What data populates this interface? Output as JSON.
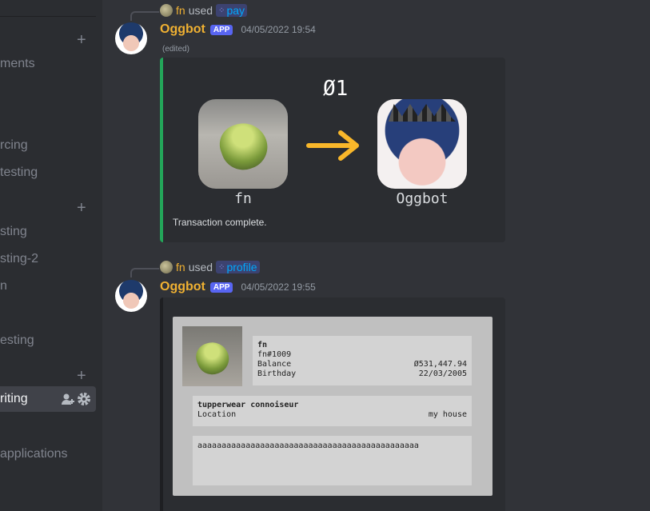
{
  "sidebar": {
    "items": [
      "ments",
      "rcing",
      "testing",
      "sting",
      "sting-2",
      "n",
      "esting",
      "applications"
    ],
    "active": "riting"
  },
  "messages": [
    {
      "reply_user": "fn",
      "reply_used": "used",
      "reply_command": "pay",
      "author": "Oggbot",
      "tag": "APP",
      "timestamp": "04/05/2022 19:54",
      "edited": "(edited)",
      "embed": {
        "amount": "Ø1",
        "from": "fn",
        "to": "Oggbot",
        "status": "Transaction complete.",
        "accent": "#23a559"
      }
    },
    {
      "reply_user": "fn",
      "reply_used": "used",
      "reply_command": "profile",
      "author": "Oggbot",
      "tag": "APP",
      "timestamp": "04/05/2022 19:55",
      "profile": {
        "name": "fn",
        "tag": "fn#1009",
        "balance_label": "Balance",
        "balance_value": "Ø531,447.94",
        "birthday_label": "Birthday",
        "birthday_value": "22/03/2005",
        "title": "tupperwear connoiseur",
        "location_label": "Location",
        "location_value": "my house",
        "bio": "aaaaaaaaaaaaaaaaaaaaaaaaaaaaaaaaaaaaaaaaaaaaaa"
      }
    }
  ],
  "colors": {
    "bot_name": "#f0b132",
    "app_tag": "#5865f2",
    "command": "#00a8fc",
    "arrow": "#f9b72a"
  }
}
